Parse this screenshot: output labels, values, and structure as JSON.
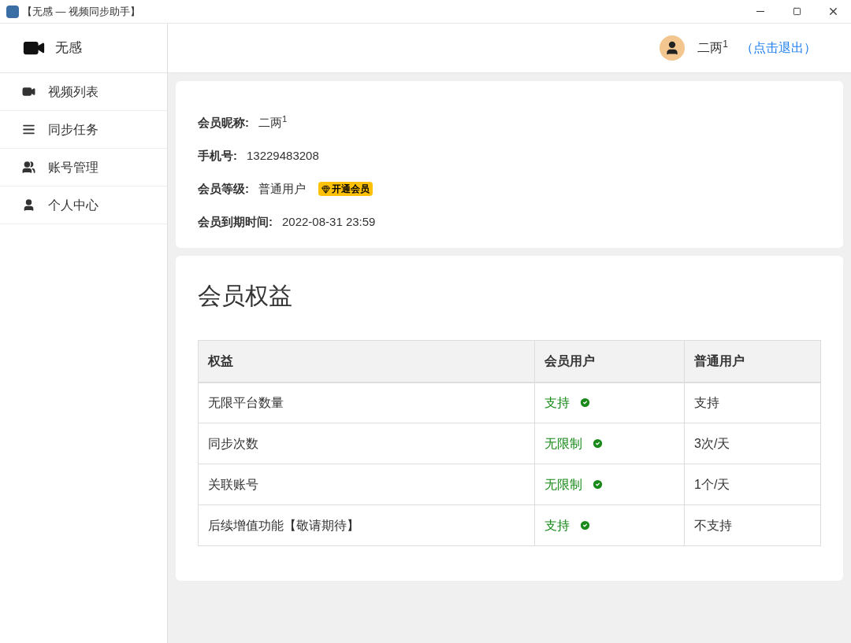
{
  "window": {
    "title": "【无感 — 视频同步助手】"
  },
  "sidebar": {
    "brand": "无感",
    "items": [
      {
        "label": "视频列表",
        "kind": "video"
      },
      {
        "label": "同步任务",
        "kind": "tasks"
      },
      {
        "label": "账号管理",
        "kind": "users"
      },
      {
        "label": "个人中心",
        "kind": "user"
      }
    ]
  },
  "header": {
    "username": "二两$^{1}$",
    "logout": "（点击退出）"
  },
  "profile": {
    "fields": [
      {
        "label": "会员昵称:",
        "value": "二两$^{1}$"
      },
      {
        "label": "手机号:",
        "value": "13229483208"
      },
      {
        "label": "会员等级:",
        "value": "普通用户",
        "badge": "开通会员"
      },
      {
        "label": "会员到期时间:",
        "value": "2022-08-31 23:59"
      }
    ]
  },
  "benefits": {
    "title": "会员权益",
    "table": {
      "columns": [
        "权益",
        "会员用户",
        "普通用户"
      ],
      "rows": [
        {
          "cells": [
            "无限平台数量",
            "支持",
            "支持"
          ]
        },
        {
          "cells": [
            "同步次数",
            "无限制",
            "3次/天"
          ]
        },
        {
          "cells": [
            "关联账号",
            "无限制",
            "1个/天"
          ]
        },
        {
          "cells": [
            "后续增值功能【敬请期待】",
            "支持",
            "不支持"
          ]
        }
      ]
    }
  }
}
